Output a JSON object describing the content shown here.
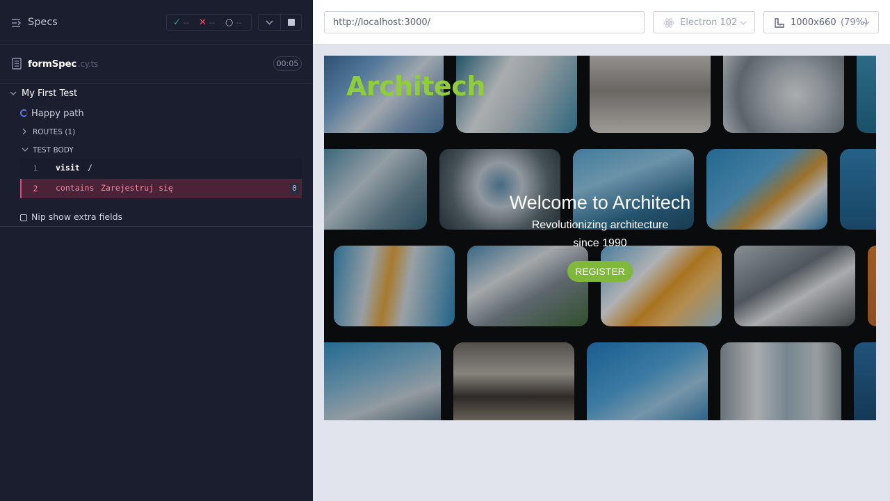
{
  "reporter": {
    "title": "Specs",
    "stats": {
      "passed": "--",
      "failed": "--",
      "pending": "--"
    },
    "file": {
      "name": "formSpec",
      "ext": ".cy.ts",
      "duration": "00:05"
    },
    "suite": {
      "title": "My First Test"
    },
    "test": {
      "title": "Happy path"
    },
    "routes_label": "ROUTES (1)",
    "body_label": "TEST BODY",
    "commands": [
      {
        "num": "1",
        "name": "visit",
        "message": "/"
      },
      {
        "num": "2",
        "name": "contains",
        "message": "Zarejestruj się",
        "count": "0"
      }
    ],
    "extra_fields_label": "Nip show extra fields"
  },
  "topbar": {
    "url": "http://localhost:3000/",
    "browser": "Electron 102",
    "viewport_size": "1000x660",
    "viewport_zoom": "(79%)"
  },
  "app": {
    "logo": "Architech",
    "hero_title": "Welcome to Architech",
    "hero_subtitle_line1": "Revolutionizing architecture",
    "hero_subtitle_line2": "since 1990",
    "register_label": "REGISTER"
  },
  "colors": {
    "reporter_bg": "#1b1e2e",
    "pass": "#2fb377",
    "fail": "#f0546c",
    "failed_command_bg": "#4a2338",
    "brand_green": "#8fcd3a",
    "register_bg": "#80b83a"
  }
}
